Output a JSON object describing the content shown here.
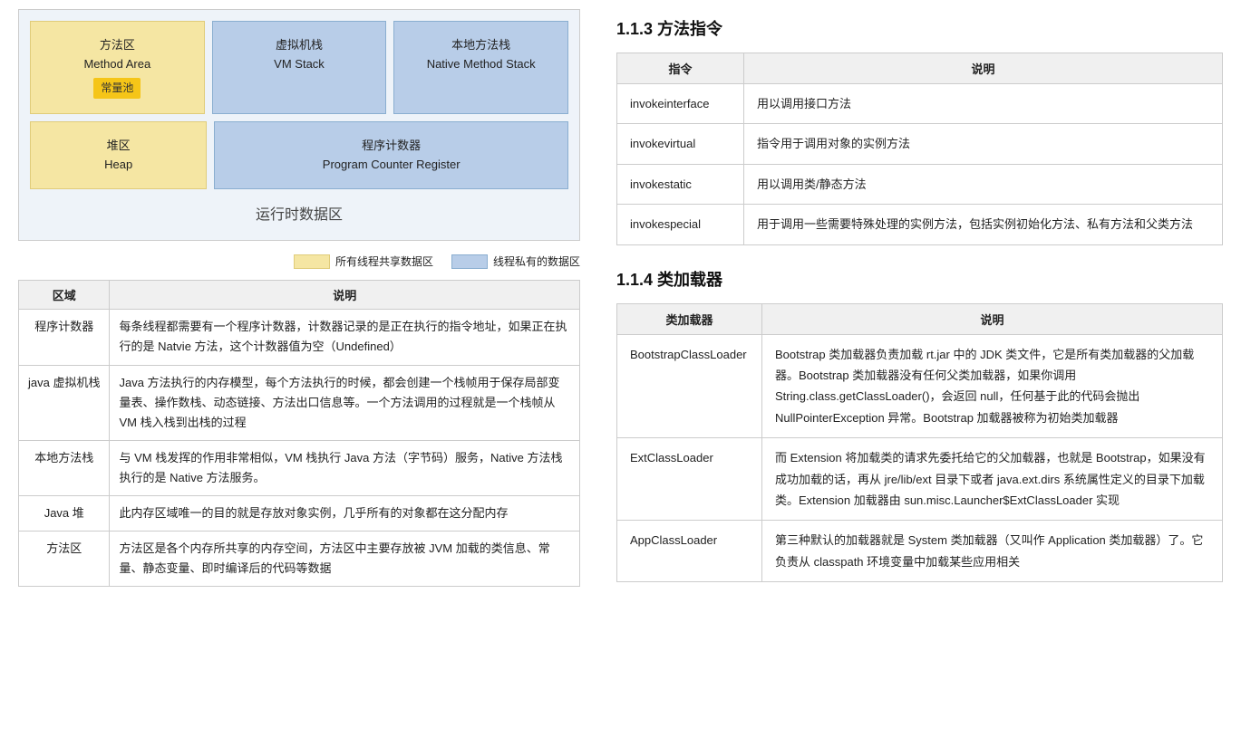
{
  "left": {
    "diagram": {
      "method_area_label": "方法区",
      "method_area_en": "Method Area",
      "constant_pool": "常量池",
      "vm_stack_label": "虚拟机栈",
      "vm_stack_en": "VM Stack",
      "native_stack_label": "本地方法栈",
      "native_stack_en": "Native Method Stack",
      "heap_label": "堆区",
      "heap_en": "Heap",
      "program_counter_label": "程序计数器",
      "program_counter_en": "Program Counter Register",
      "runtime_area": "运行时数据区"
    },
    "legend": {
      "shared": "所有线程共享数据区",
      "private": "线程私有的数据区"
    },
    "table": {
      "col_area": "区域",
      "col_desc": "说明",
      "rows": [
        {
          "area": "程序计数器",
          "desc": "每条线程都需要有一个程序计数器，计数器记录的是正在执行的指令地址，如果正在执行的是 Natvie 方法，这个计数器值为空（Undefined）"
        },
        {
          "area": "java 虚拟机栈",
          "desc": "Java 方法执行的内存模型，每个方法执行的时候，都会创建一个栈帧用于保存局部变量表、操作数栈、动态链接、方法出口信息等。一个方法调用的过程就是一个栈帧从 VM 栈入栈到出栈的过程"
        },
        {
          "area": "本地方法栈",
          "desc": "与 VM 栈发挥的作用非常相似，VM 栈执行 Java 方法（字节码）服务，Native 方法栈执行的是 Native 方法服务。"
        },
        {
          "area": "Java 堆",
          "desc": "此内存区域唯一的目的就是存放对象实例，几乎所有的对象都在这分配内存"
        },
        {
          "area": "方法区",
          "desc": "方法区是各个内存所共享的内存空间，方法区中主要存放被 JVM 加载的类信息、常量、静态变量、即时编译后的代码等数据"
        }
      ]
    }
  },
  "right": {
    "section1": {
      "title": "1.1.3  方法指令",
      "table": {
        "col_cmd": "指令",
        "col_desc": "说明",
        "rows": [
          {
            "cmd": "invokeinterface",
            "desc": "用以调用接口方法"
          },
          {
            "cmd": "invokevirtual",
            "desc": "指令用于调用对象的实例方法"
          },
          {
            "cmd": "invokestatic",
            "desc": "用以调用类/静态方法"
          },
          {
            "cmd": "invokespecial",
            "desc": "用于调用一些需要特殊处理的实例方法，包括实例初始化方法、私有方法和父类方法"
          }
        ]
      }
    },
    "section2": {
      "title": "1.1.4  类加载器",
      "table": {
        "col_loader": "类加载器",
        "col_desc": "说明",
        "rows": [
          {
            "loader": "BootstrapClassLoader",
            "desc": "Bootstrap 类加载器负责加载 rt.jar 中的 JDK 类文件，它是所有类加载器的父加载器。Bootstrap 类加载器没有任何父类加载器，如果你调用 String.class.getClassLoader()，会返回 null，任何基于此的代码会抛出 NullPointerException 异常。Bootstrap 加载器被称为初始类加载器"
          },
          {
            "loader": "ExtClassLoader",
            "desc": "而 Extension 将加载类的请求先委托给它的父加载器，也就是 Bootstrap，如果没有成功加载的话，再从 jre/lib/ext 目录下或者 java.ext.dirs 系统属性定义的目录下加载类。Extension 加载器由 sun.misc.Launcher$ExtClassLoader 实现"
          },
          {
            "loader": "AppClassLoader",
            "desc": "第三种默认的加载器就是 System 类加载器（又叫作 Application 类加载器）了。它负责从 classpath 环境变量中加载某些应用相关"
          }
        ]
      }
    }
  }
}
